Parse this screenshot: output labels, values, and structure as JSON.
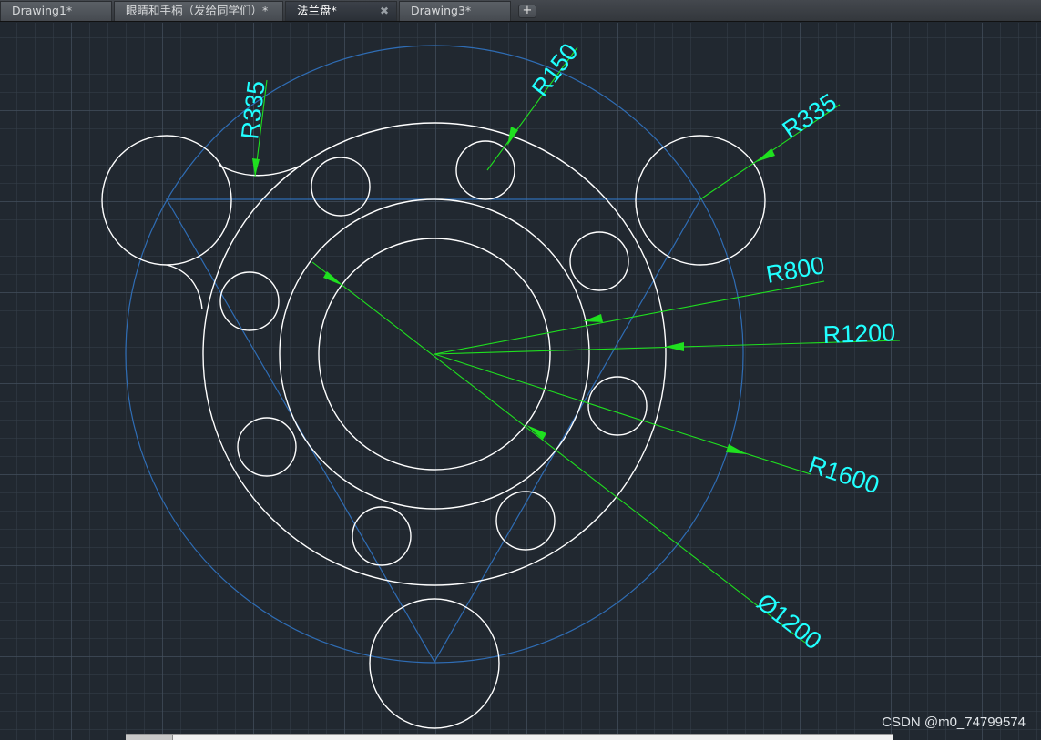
{
  "tabs": [
    {
      "label": "Drawing1*",
      "active": false
    },
    {
      "label": "眼睛和手柄（发给同学们）*",
      "active": false
    },
    {
      "label": "法兰盘*",
      "active": true,
      "close": "✖"
    },
    {
      "label": "Drawing3*",
      "active": false
    }
  ],
  "new_tab_label": "+",
  "dimensions": {
    "r150": "R150",
    "r335_left": "R335",
    "r335_right": "R335",
    "r800": "R800",
    "r1200": "R1200",
    "r1600": "R1600",
    "d1200": "Ø1200"
  },
  "watermark": "CSDN @m0_74799574",
  "colors": {
    "background": "#212830",
    "geometry": "#ffffff",
    "construction": "#2f6db5",
    "dimension_line": "#1fe01f",
    "dimension_text": "#21ffff"
  },
  "icons": {
    "tab_close": "close-icon",
    "new_tab": "plus-icon"
  }
}
